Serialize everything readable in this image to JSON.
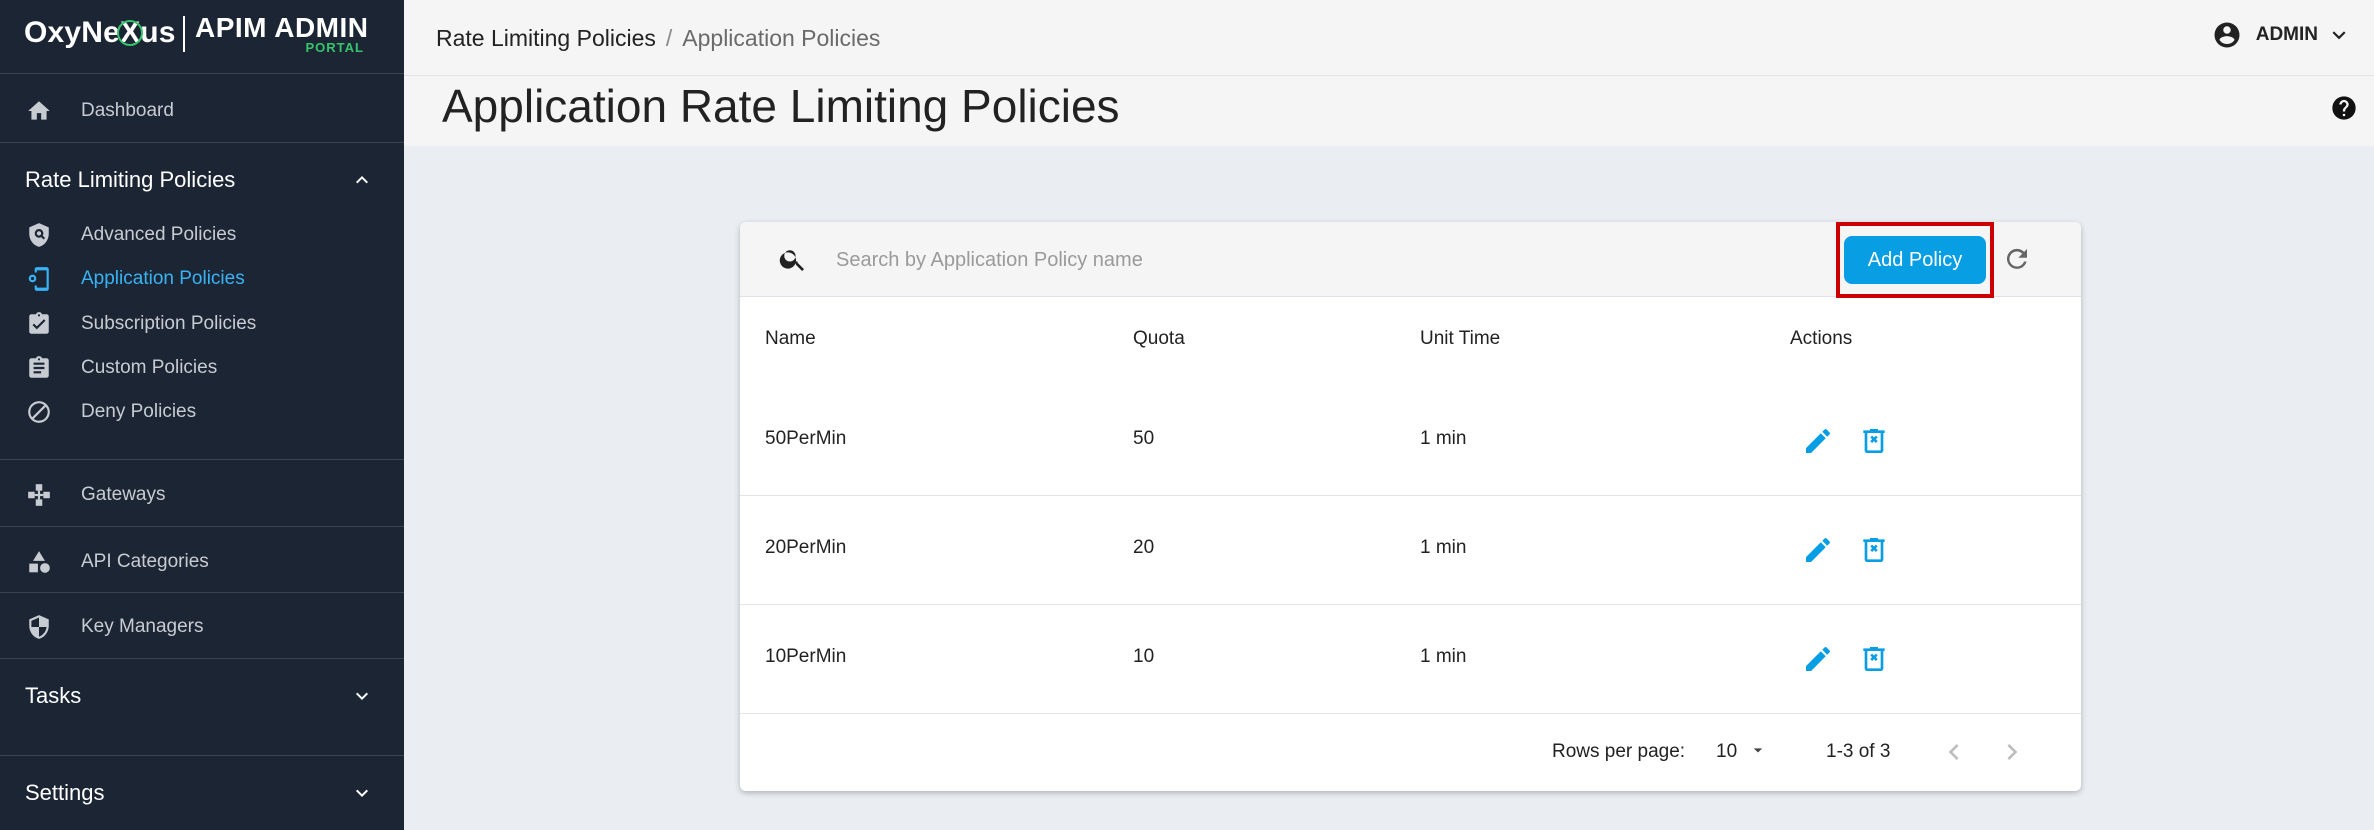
{
  "brand": {
    "logo_pre": "OxyNe",
    "logo_x": "X",
    "logo_post": "us",
    "title": "APIM ADMIN",
    "subtitle": "PORTAL"
  },
  "sidebar": {
    "dashboard": "Dashboard",
    "rate_group": "Rate Limiting Policies",
    "rate_items": [
      "Advanced Policies",
      "Application Policies",
      "Subscription Policies",
      "Custom Policies",
      "Deny Policies"
    ],
    "gateways": "Gateways",
    "api_categories": "API Categories",
    "key_managers": "Key Managers",
    "tasks": "Tasks",
    "settings": "Settings"
  },
  "breadcrumb": {
    "parent": "Rate Limiting Policies",
    "sep": "/",
    "current": "Application Policies"
  },
  "user": {
    "name": "ADMIN"
  },
  "page": {
    "title": "Application Rate Limiting Policies"
  },
  "search": {
    "placeholder": "Search by Application Policy name",
    "value": ""
  },
  "add_button": "Add Policy",
  "table": {
    "headers": [
      "Name",
      "Quota",
      "Unit Time",
      "Actions"
    ],
    "rows": [
      {
        "name": "50PerMin",
        "quota": "50",
        "unit": "1 min"
      },
      {
        "name": "20PerMin",
        "quota": "20",
        "unit": "1 min"
      },
      {
        "name": "10PerMin",
        "quota": "10",
        "unit": "1 min"
      }
    ]
  },
  "pagination": {
    "rows_label": "Rows per page:",
    "rows_value": "10",
    "range": "1-3 of 3"
  },
  "colors": {
    "accent": "#079ee4",
    "sidebar_bg": "#1c2533",
    "active_link": "#38b3f5",
    "highlight": "#cc0000"
  }
}
